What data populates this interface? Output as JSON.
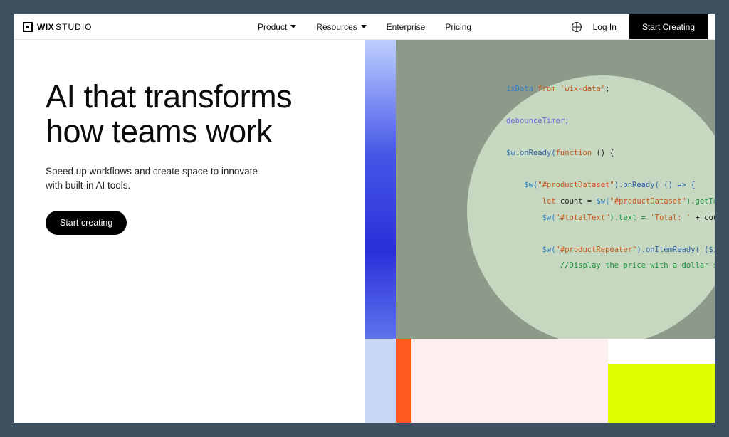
{
  "header": {
    "logo_wix": "WIX",
    "logo_studio": "STUDIO",
    "nav": {
      "product": "Product",
      "resources": "Resources",
      "enterprise": "Enterprise",
      "pricing": "Pricing"
    },
    "login": "Log In",
    "start_creating": "Start Creating"
  },
  "hero": {
    "headline": "AI that transforms how teams work",
    "sub": "Speed up workflows and create space to innovate with built-in AI tools.",
    "cta": "Start creating"
  },
  "code": {
    "l1_a": "ixData ",
    "l1_b": "from ",
    "l1_c": "'wix-data'",
    "l1_d": ";",
    "l2": "debounceTimer;",
    "l3_a": "$w",
    "l3_b": ".onReady(",
    "l3_c": "function ",
    "l3_d": "() {",
    "l4_a": "$w(",
    "l4_b": "\"#productDataset\"",
    "l4_c": ").onReady( () => {",
    "l5_a": "let ",
    "l5_b": "count = ",
    "l5_c": "$w(",
    "l5_d": "\"#productDataset\"",
    "l5_e": ").getTotalCount()",
    "l6_a": "$w(",
    "l6_b": "\"#totalText\"",
    "l6_c": ").text = ",
    "l6_d": "'Total: '",
    "l6_e": " + count;",
    "l7_a": "$w(",
    "l7_b": "\"#productRepeater\"",
    "l7_c": ").onItemReady( ($item, item",
    "l8": "//Display the price with a dollar sign in f"
  }
}
